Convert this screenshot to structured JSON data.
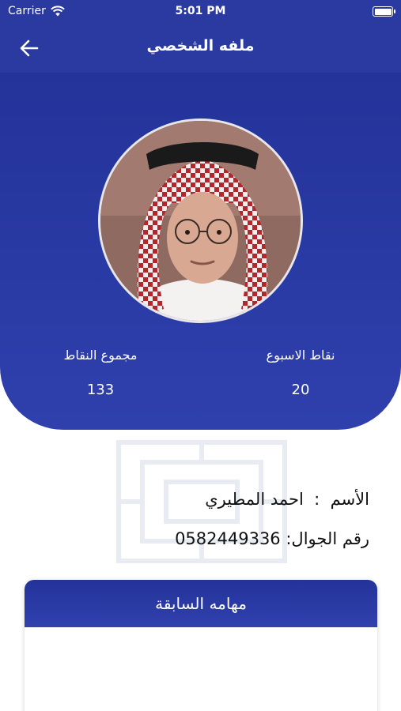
{
  "status_bar": {
    "carrier": "Carrier",
    "time": "5:01 PM"
  },
  "nav": {
    "title": "ملفه الشخصي",
    "back_icon": "arrow-left-icon"
  },
  "profile": {
    "avatar_alt": "avatar",
    "stats": {
      "week_points_label": "نقاط الاسبوع",
      "week_points_value": "20",
      "total_points_label": "مجموع النقاط",
      "total_points_value": "133"
    }
  },
  "info": {
    "name_label": "الأسم",
    "name_value": "احمد المطيري",
    "phone_label": "رقم الجوال:",
    "phone_value": "0582449336"
  },
  "tasks": {
    "title": "مهامه السابقة"
  },
  "colors": {
    "primary": "#2a3aa0",
    "background": "#ffffff"
  }
}
